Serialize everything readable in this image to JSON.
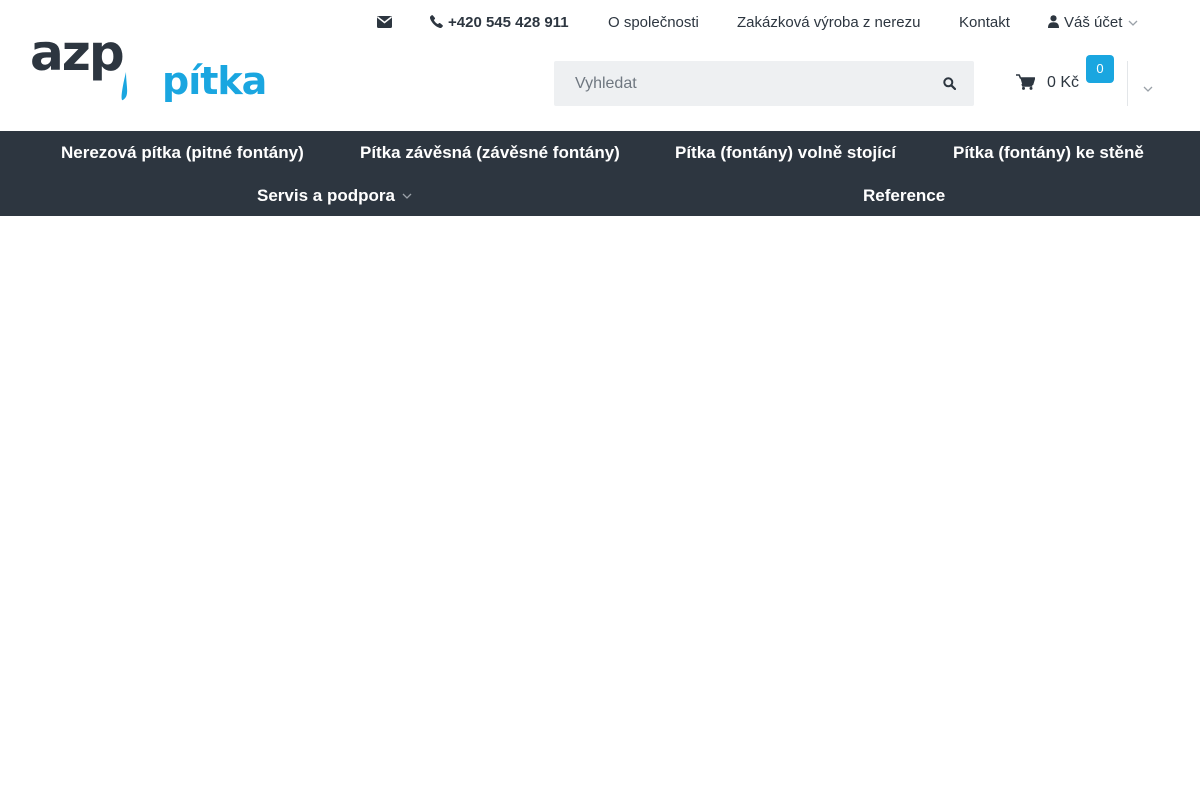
{
  "brand": {
    "logo_top": "azp",
    "logo_bottom": "pítka",
    "colors": {
      "dark": "#2d3640",
      "accent": "#1aa6e0"
    }
  },
  "topbar": {
    "mail_icon": "envelope-icon",
    "phone_icon": "phone-icon",
    "phone": "+420 545 428 911",
    "about": "O společnosti",
    "custom": "Zakázková výroba z nerezu",
    "contact": "Kontakt",
    "account_icon": "user-icon",
    "account": "Váš účet"
  },
  "search": {
    "placeholder": "Vyhledat",
    "icon": "search-icon"
  },
  "cart": {
    "icon": "shopping-cart-icon",
    "price": "0 Kč",
    "count": "0"
  },
  "nav": {
    "items": [
      {
        "label": "Nerezová pítka (pitné fontány)"
      },
      {
        "label": "Pítka závěsná (závěsné fontány)"
      },
      {
        "label": "Pítka (fontány) volně stojící"
      },
      {
        "label": "Pítka (fontány) ke stěně"
      },
      {
        "label": "Servis a podpora"
      },
      {
        "label": "Reference"
      }
    ]
  }
}
